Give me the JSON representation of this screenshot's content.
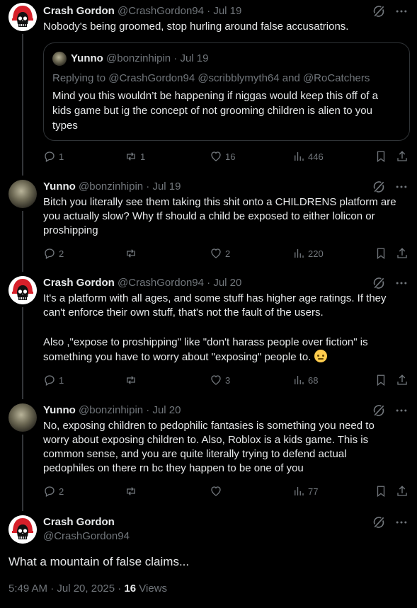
{
  "tweets": [
    {
      "name": "Crash Gordon",
      "handle": "@CrashGordon94",
      "date": "· Jul 19",
      "text": "Nobody's being groomed, stop hurling around false accusatrions.",
      "quote": {
        "name": "Yunno",
        "handle": "@bonzinhipin",
        "date": "· Jul 19",
        "replying": "Replying to @CrashGordon94 @scribblymyth64 and @RoCatchers",
        "text": "Mind you this wouldn’t be happening if niggas would keep this off of a kids game but ig the concept of not grooming children is alien to you types"
      },
      "stats": {
        "replies": "1",
        "reposts": "1",
        "likes": "16",
        "views": "446"
      }
    },
    {
      "name": "Yunno",
      "handle": "@bonzinhipin",
      "date": "· Jul 19",
      "text": "Bitch you literally see them taking this shit onto a CHILDRENS platform are you actually slow? Why tf should a child be exposed to either lolicon or proshipping",
      "stats": {
        "replies": "2",
        "reposts": "",
        "likes": "2",
        "views": "220"
      }
    },
    {
      "name": "Crash Gordon",
      "handle": "@CrashGordon94",
      "date": "· Jul 20",
      "text": "It's a platform with all ages, and some stuff has higher age ratings. If they can't enforce their own stuff, that's not the fault of the users.",
      "text2": "Also ,\"expose to proshipping\" like \"don't harass people over fiction\" is something you have to worry about \"exposing\" people to.",
      "stats": {
        "replies": "1",
        "reposts": "",
        "likes": "3",
        "views": "68"
      }
    },
    {
      "name": "Yunno",
      "handle": "@bonzinhipin",
      "date": "· Jul 20",
      "text": "No, exposing children to pedophilic fantasies is something you need to worry about exposing children to. Also, Roblox is a kids game. This is common sense, and you are quite literally trying to defend actual pedophiles on there rn bc they happen to be one of you",
      "stats": {
        "replies": "2",
        "reposts": "",
        "likes": "",
        "views": "77"
      }
    }
  ],
  "main": {
    "name": "Crash Gordon",
    "handle": "@CrashGordon94",
    "text": "What a mountain of false claims...",
    "time": "5:49 AM · Jul 20, 2025 · ",
    "views_count": "16",
    "views_label": " Views"
  },
  "icons": [
    "crash-skull-avatar",
    "yunno-avatar",
    "grok-icon",
    "more-icon",
    "reply-icon",
    "repost-icon",
    "like-icon",
    "views-icon",
    "bookmark-icon",
    "share-icon",
    "rolling-eyes-emoji"
  ],
  "colors": {
    "background": "#000000",
    "text": "#e7e9ea",
    "secondary": "#71767b",
    "border": "#2f3336"
  }
}
